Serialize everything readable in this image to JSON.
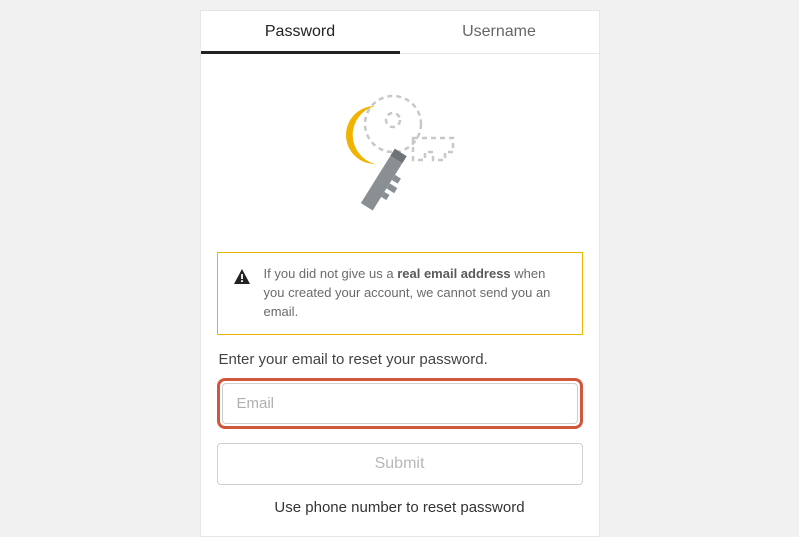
{
  "tabs": {
    "password": "Password",
    "username": "Username"
  },
  "alert": {
    "text_before": "If you did not give us a ",
    "bold": "real email address",
    "text_after": " when you created your account, we cannot send you an email."
  },
  "prompt": "Enter your email to reset your password.",
  "email_placeholder": "Email",
  "submit_label": "Submit",
  "phone_link": "Use phone number to reset password"
}
